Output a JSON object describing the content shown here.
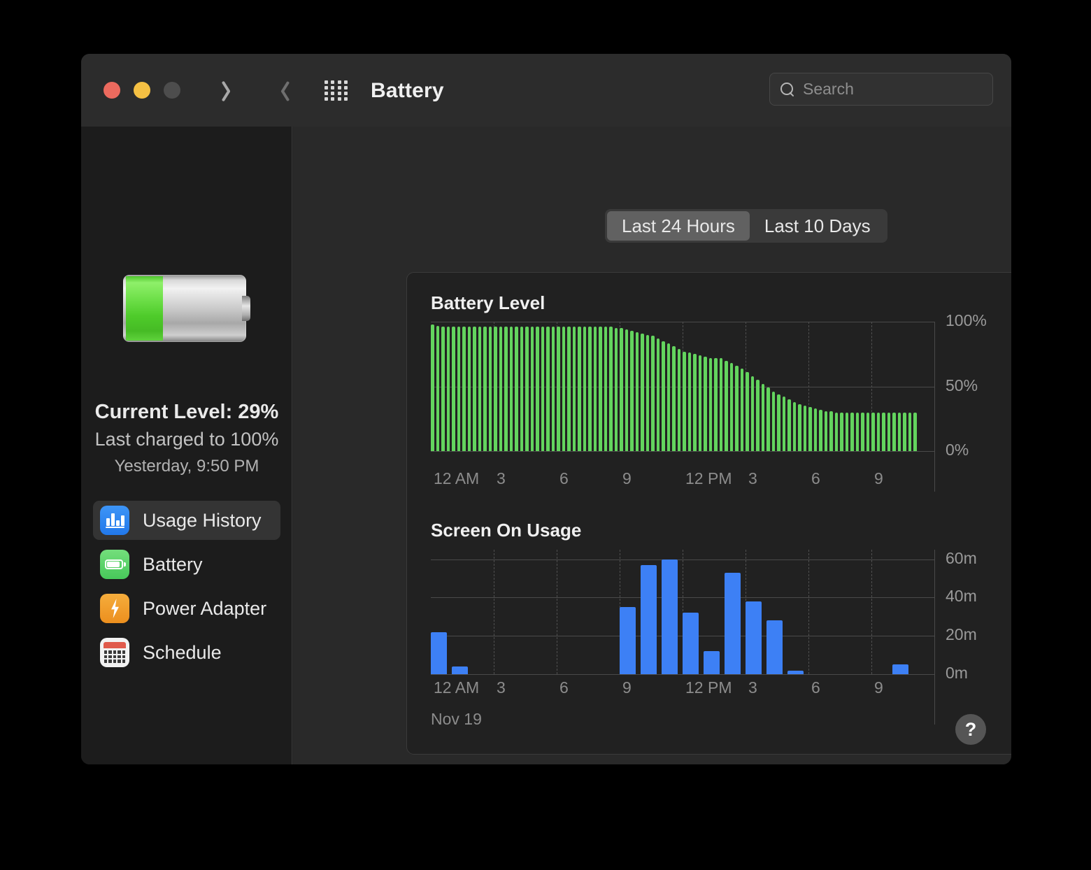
{
  "window": {
    "title": "Battery",
    "traffic_lights": [
      {
        "name": "close",
        "color": "#ec6a5e"
      },
      {
        "name": "minimize",
        "color": "#f5c043"
      },
      {
        "name": "zoom",
        "color": "#4d4d4d"
      }
    ],
    "back_icon": "chevron-left-icon",
    "forward_icon": "chevron-right-icon",
    "grid_icon": "show-all-preferences-icon"
  },
  "search": {
    "placeholder": "Search",
    "icon": "search-icon",
    "value": ""
  },
  "sidebar": {
    "battery_icon": "battery-glyph-icon",
    "current_level": "Current Level: 29%",
    "last_charged": "Last charged to 100%",
    "last_charged_time": "Yesterday, 9:50 PM",
    "battery_fill_percent": 29,
    "items": [
      {
        "label": "Usage History",
        "icon": "bar-chart-icon",
        "icon_color": "#2e86f0",
        "selected": true
      },
      {
        "label": "Battery",
        "icon": "battery-icon",
        "icon_color": "#5ad066",
        "selected": false
      },
      {
        "label": "Power Adapter",
        "icon": "bolt-icon",
        "icon_color": "#f09a28",
        "selected": false
      },
      {
        "label": "Schedule",
        "icon": "calendar-icon",
        "icon_color": "#e05a4b",
        "selected": false
      }
    ]
  },
  "segmented_control": {
    "options": [
      {
        "label": "Last 24 Hours",
        "selected": true
      },
      {
        "label": "Last 10 Days",
        "selected": false
      }
    ]
  },
  "help_button": {
    "label": "?"
  },
  "colors": {
    "battery_bar": "#63d45e",
    "usage_bar": "#3d80f5",
    "panel_bg": "#212121",
    "content_bg": "#292929",
    "sidebar_bg": "#1c1c1c"
  },
  "chart_data": [
    {
      "type": "bar",
      "title": "Battery Level",
      "xlabel": "",
      "ylabel": "",
      "ylim": [
        0,
        100
      ],
      "ytick_labels": [
        "100%",
        "50%",
        "0%"
      ],
      "ytick_values": [
        100,
        50,
        0
      ],
      "xtick_labels": [
        "12 AM",
        "3",
        "6",
        "9",
        "12 PM",
        "3",
        "6",
        "9"
      ],
      "xtick_hours": [
        0,
        3,
        6,
        9,
        12,
        15,
        18,
        21
      ],
      "grid": true,
      "legend": "none",
      "bar_color": "#63d45e",
      "x_hours": [
        0.0,
        0.25,
        0.5,
        0.75,
        1.0,
        1.25,
        1.5,
        1.75,
        2.0,
        2.25,
        2.5,
        2.75,
        3.0,
        3.25,
        3.5,
        3.75,
        4.0,
        4.25,
        4.5,
        4.75,
        5.0,
        5.25,
        5.5,
        5.75,
        6.0,
        6.25,
        6.5,
        6.75,
        7.0,
        7.25,
        7.5,
        7.75,
        8.0,
        8.25,
        8.5,
        8.75,
        9.0,
        9.25,
        9.5,
        9.75,
        10.0,
        10.25,
        10.5,
        10.75,
        11.0,
        11.25,
        11.5,
        11.75,
        12.0,
        12.25,
        12.5,
        12.75,
        13.0,
        13.25,
        13.5,
        13.75,
        14.0,
        14.25,
        14.5,
        14.75,
        15.0,
        15.25,
        15.5,
        15.75,
        16.0,
        16.25,
        16.5,
        16.75,
        17.0,
        17.25,
        17.5,
        17.75,
        18.0,
        18.25,
        18.5,
        18.75,
        19.0,
        19.25,
        19.5,
        19.75,
        20.0,
        20.25,
        20.5,
        20.75,
        21.0,
        21.25,
        21.5,
        21.75,
        22.0,
        22.25,
        22.5,
        22.75,
        23.0
      ],
      "values": [
        98,
        97,
        96,
        96,
        96,
        96,
        96,
        96,
        96,
        96,
        96,
        96,
        96,
        96,
        96,
        96,
        96,
        96,
        96,
        96,
        96,
        96,
        96,
        96,
        96,
        96,
        96,
        96,
        96,
        96,
        96,
        96,
        96,
        96,
        96,
        95,
        95,
        94,
        93,
        92,
        91,
        90,
        89,
        87,
        85,
        83,
        81,
        79,
        77,
        76,
        75,
        74,
        73,
        72,
        72,
        72,
        70,
        68,
        66,
        64,
        61,
        58,
        55,
        52,
        49,
        46,
        44,
        42,
        40,
        38,
        36,
        35,
        34,
        33,
        32,
        31,
        31,
        30,
        30,
        30,
        30,
        30,
        30,
        30,
        30,
        30,
        30,
        30,
        30,
        30,
        30,
        30,
        30
      ],
      "note": "Battery level percentage sampled in 15-minute increments over the last 24 hours, declining from ~98% at midnight to ~30% at 11 PM"
    },
    {
      "type": "bar",
      "title": "Screen On Usage",
      "xlabel": "",
      "ylabel": "",
      "ylim": [
        0,
        65
      ],
      "ytick_labels": [
        "60m",
        "40m",
        "20m",
        "0m"
      ],
      "ytick_values": [
        60,
        40,
        20,
        0
      ],
      "xtick_labels": [
        "12 AM",
        "3",
        "6",
        "9",
        "12 PM",
        "3",
        "6",
        "9"
      ],
      "xtick_hours": [
        0,
        3,
        6,
        9,
        12,
        15,
        18,
        21
      ],
      "date_label": "Nov 19",
      "grid": true,
      "legend": "none",
      "bar_color": "#3d80f5",
      "categories": [
        "12 AM",
        "1 AM",
        "2 AM",
        "3 AM",
        "4 AM",
        "5 AM",
        "6 AM",
        "7 AM",
        "8 AM",
        "9 AM",
        "10 AM",
        "11 AM",
        "12 PM",
        "1 PM",
        "2 PM",
        "3 PM",
        "4 PM",
        "5 PM",
        "6 PM",
        "7 PM",
        "8 PM",
        "9 PM",
        "10 PM",
        "11 PM"
      ],
      "values": [
        22,
        4,
        0,
        0,
        0,
        0,
        0,
        0,
        0,
        35,
        57,
        60,
        32,
        12,
        53,
        38,
        28,
        2,
        0,
        0,
        0,
        0,
        5,
        0
      ],
      "unit": "minutes",
      "note": "Minutes of screen-on time per hour over the last 24 hours"
    }
  ]
}
